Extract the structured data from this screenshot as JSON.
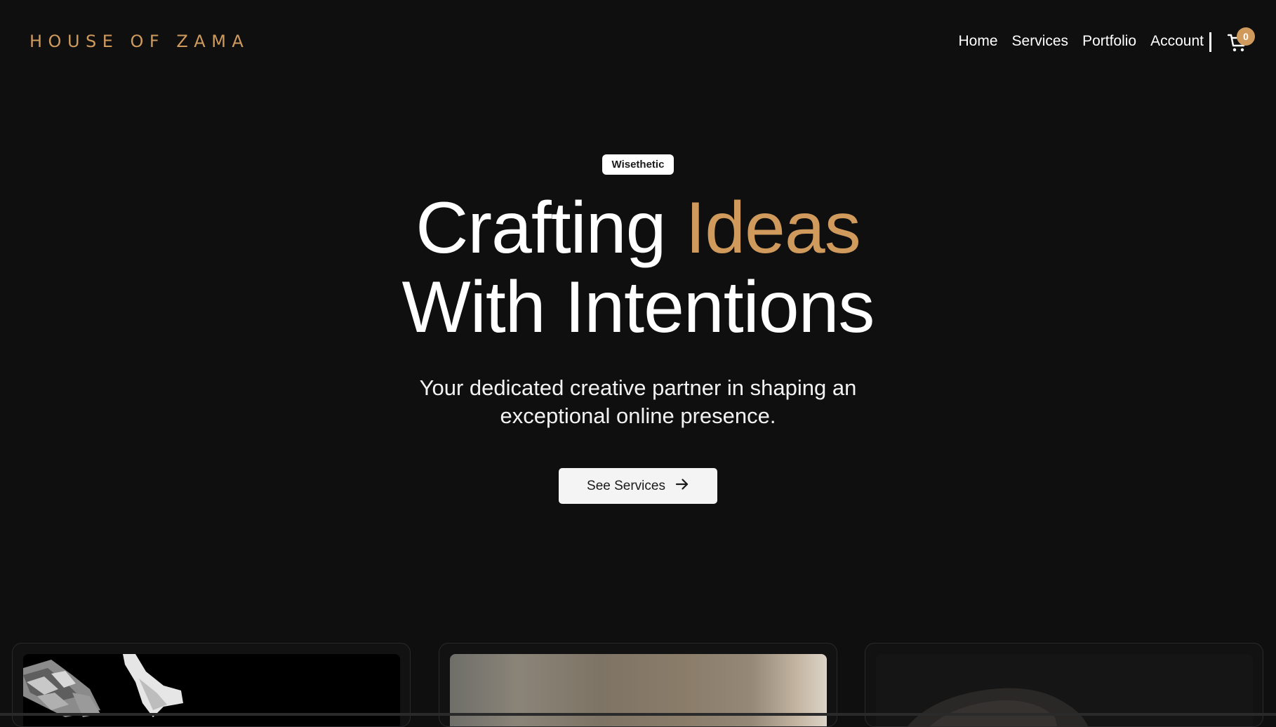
{
  "brand": {
    "logo": "HOUSE OF ZAMA",
    "accent_color": "#cf9a5c",
    "background_color": "#0f0f10"
  },
  "nav": {
    "items": [
      {
        "label": "Home"
      },
      {
        "label": "Services"
      },
      {
        "label": "Portfolio"
      },
      {
        "label": "Account"
      }
    ],
    "cart_count": "0",
    "cart_icon": "cart-icon"
  },
  "hero": {
    "tag": "Wisethetic",
    "headline_part1": "Crafting ",
    "headline_accent": "Ideas",
    "headline_line2": "With Intentions",
    "subtitle": "Your dedicated creative partner in shaping an exceptional online presence.",
    "cta_label": "See Services",
    "cta_icon": "arrow-right-icon"
  }
}
